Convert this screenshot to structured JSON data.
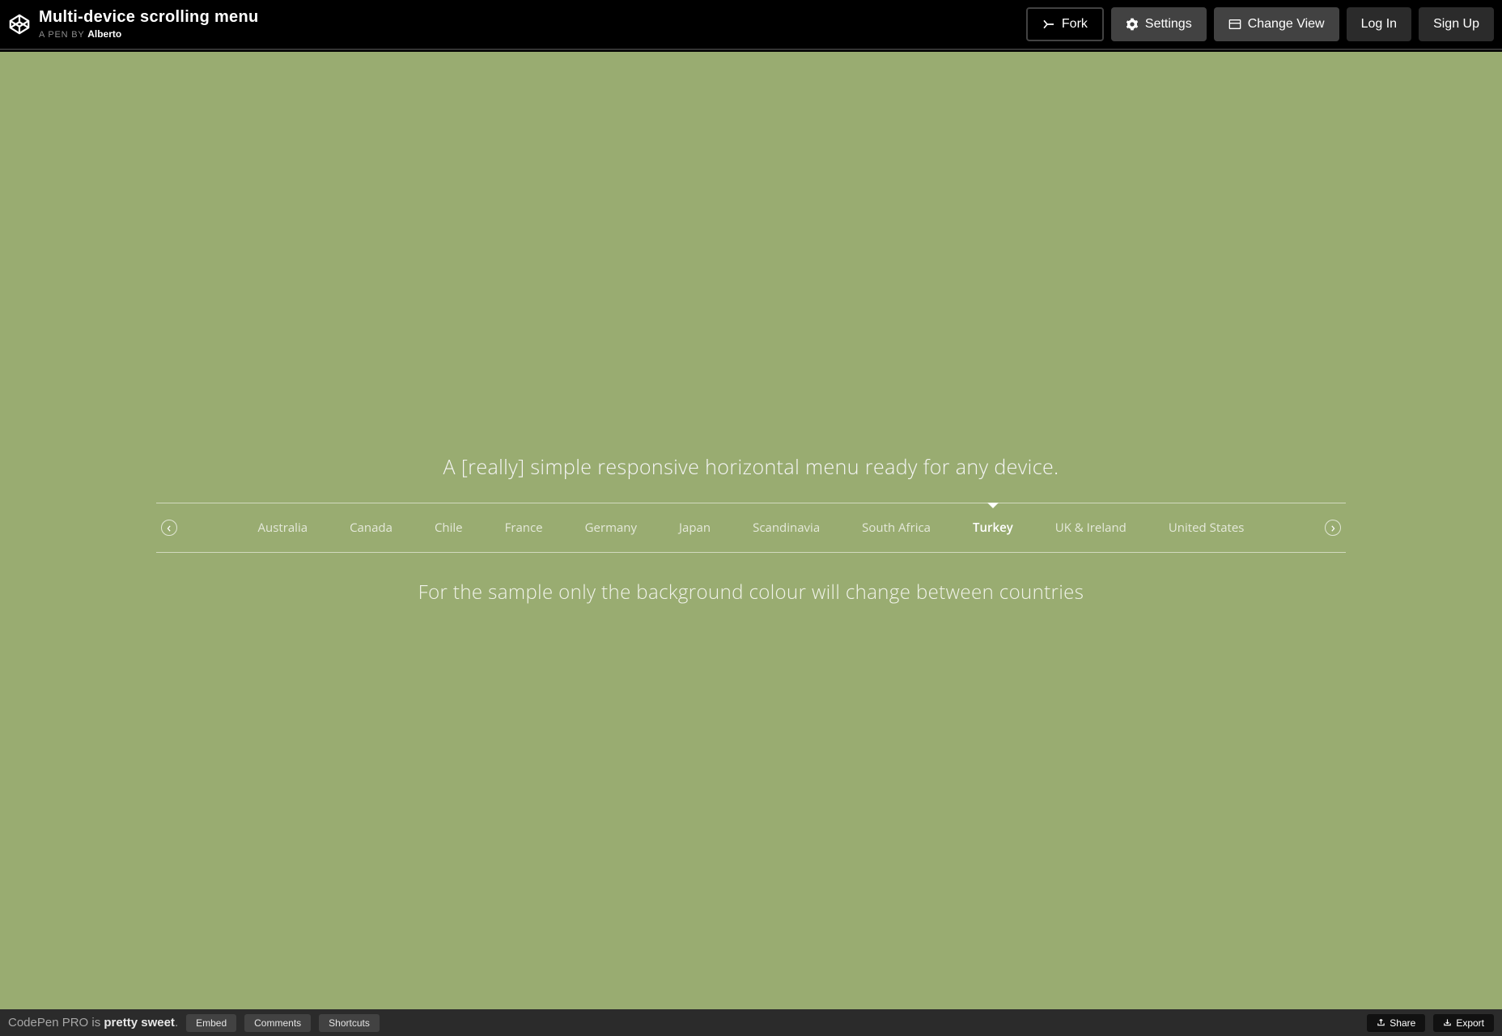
{
  "header": {
    "title": "Multi-device scrolling menu",
    "pen_by_prefix": "A PEN BY ",
    "author": "Alberto",
    "buttons": {
      "fork": "Fork",
      "settings": "Settings",
      "change_view": "Change View",
      "login": "Log In",
      "signup": "Sign Up"
    }
  },
  "preview": {
    "lead": "A [really] simple responsive horizontal menu ready for any device.",
    "sub": "For the sample only the background colour will change between countries",
    "background_color": "#99ac71",
    "active_index": 8,
    "items": [
      "Australia",
      "Canada",
      "Chile",
      "France",
      "Germany",
      "Japan",
      "Scandinavia",
      "South Africa",
      "Turkey",
      "UK & Ireland",
      "United States"
    ]
  },
  "footer": {
    "promo_prefix": "CodePen PRO is ",
    "promo_highlight": "pretty sweet",
    "promo_suffix": ".",
    "embed": "Embed",
    "comments": "Comments",
    "shortcuts": "Shortcuts",
    "share": "Share",
    "export": "Export"
  }
}
